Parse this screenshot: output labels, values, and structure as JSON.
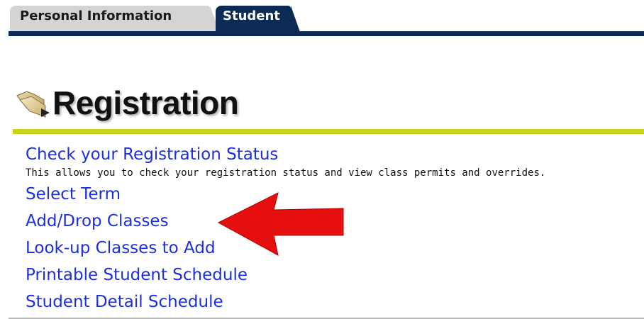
{
  "tabs": [
    {
      "label": "Personal Information",
      "active": false
    },
    {
      "label": "Student",
      "active": true
    }
  ],
  "page": {
    "title": "Registration",
    "icon": "folder-icon"
  },
  "links": [
    {
      "label": "Check your Registration Status",
      "description": "This allows you to check your registration status and view class permits and overrides."
    },
    {
      "label": "Select Term"
    },
    {
      "label": "Add/Drop Classes"
    },
    {
      "label": "Look-up Classes to Add"
    },
    {
      "label": "Printable Student Schedule"
    },
    {
      "label": "Student Detail Schedule"
    }
  ],
  "annotation": {
    "icon": "red-arrow-icon",
    "points_to": "Add/Drop Classes",
    "color": "#e60f0f"
  },
  "colors": {
    "tab_active": "#0b2b55",
    "tab_inactive": "#d4d4d4",
    "accent": "#cbd21c",
    "link": "#1c2fe0"
  }
}
